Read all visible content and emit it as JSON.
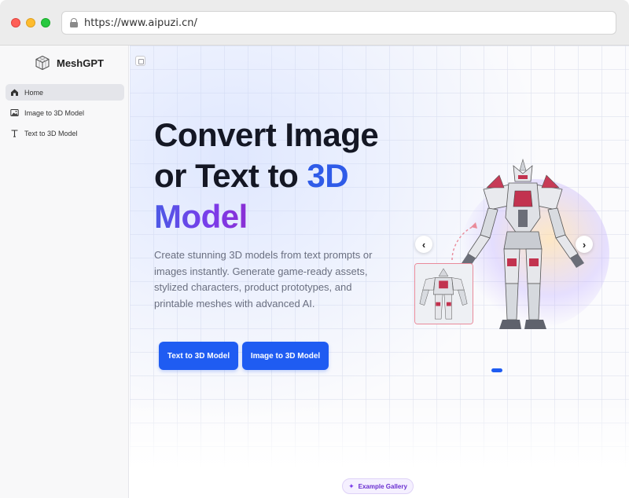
{
  "browser": {
    "url": "https://www.aipuzi.cn/"
  },
  "sidebar": {
    "brand": "MeshGPT",
    "items": [
      {
        "label": "Home",
        "icon": "home-icon",
        "active": true
      },
      {
        "label": "Image to 3D Model",
        "icon": "image-icon",
        "active": false
      },
      {
        "label": "Text to 3D Model",
        "icon": "text-icon",
        "active": false
      }
    ]
  },
  "hero": {
    "title_line1": "Convert Image",
    "title_line2_prefix": "or Text to ",
    "title_line2_accent": "3D",
    "title_line3": "Model",
    "description": "Create stunning 3D models from text prompts or images instantly. Generate game-ready assets, stylized characters, product prototypes, and printable meshes with advanced AI.",
    "buttons": {
      "text_to_3d": "Text to 3D Model",
      "image_to_3d": "Image to 3D Model"
    }
  },
  "carousel": {
    "prev_icon": "‹",
    "next_icon": "›",
    "active_index": 0,
    "count": 1
  },
  "gallery": {
    "label": "Example Gallery",
    "icon": "sparkle-icon"
  },
  "colors": {
    "accent": "#1f5cf2",
    "title_dark": "#141724",
    "gradient_start": "#4b59e6",
    "gradient_end": "#8a2fd4"
  }
}
